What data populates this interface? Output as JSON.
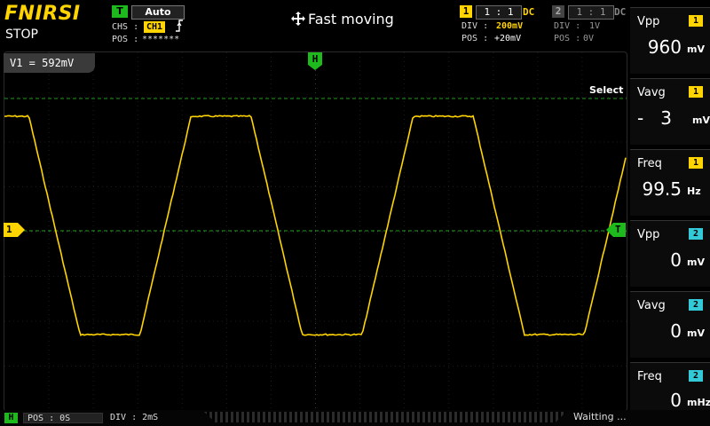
{
  "brand": "FNIRSI",
  "run_state": "STOP",
  "trigger": {
    "badge": "T",
    "mode": "Auto",
    "chs_label": "CHS :",
    "chs_value": "CH1",
    "edge_symbol": "⸽",
    "pos_label": "POS :",
    "pos_value": "*******"
  },
  "header_center": {
    "icon": "move-arrows-icon",
    "text": "Fast moving"
  },
  "ch1": {
    "number": "1",
    "probe": "1 : 1",
    "coupling": "DC",
    "div_label": "DIV :",
    "div_value": "200mV",
    "pos_label": "POS :",
    "pos_value": "+20mV",
    "color": "#ffd400"
  },
  "ch2": {
    "number": "2",
    "probe": "1 : 1",
    "coupling": "DC",
    "div_label": "DIV :",
    "div_value": "1V",
    "pos_label": "POS :",
    "pos_value": "0V",
    "color": "#34c9d6"
  },
  "cursor": {
    "readout": "V1 = 592mV",
    "select_label": "Select",
    "h_marker": "H",
    "ch1_marker": "1",
    "trigger_marker": "T"
  },
  "measurements": [
    {
      "label": "Vpp",
      "channel": "1",
      "value": "960",
      "unit": "mV"
    },
    {
      "label": "Vavg",
      "channel": "1",
      "value": "-   3",
      "unit": "mV"
    },
    {
      "label": "Freq",
      "channel": "1",
      "value": "99.5",
      "unit": "Hz"
    },
    {
      "label": "Vpp",
      "channel": "2",
      "value": "0",
      "unit": "mV"
    },
    {
      "label": "Vavg",
      "channel": "2",
      "value": "0",
      "unit": "mV"
    },
    {
      "label": "Freq",
      "channel": "2",
      "value": "0",
      "unit": "mHz"
    }
  ],
  "bottom": {
    "h_badge": "H",
    "pos_label": "POS : 0S",
    "div_label": "DIV : 2mS",
    "status": "Waitting ..."
  },
  "waveform": {
    "shape": "trapezoid",
    "period_ms": 10,
    "visible_periods": 2.8,
    "color": "#ffd400"
  }
}
